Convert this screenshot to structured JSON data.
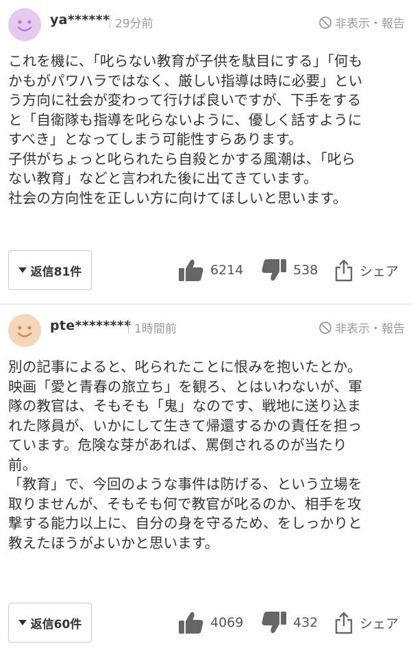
{
  "comments": [
    {
      "username": "ya******",
      "time": "29分前",
      "hide_label": "非表示・報告",
      "body": "これを機に、「叱らない教育が子供を駄目にする」「何も\nかもがパワハラではなく、厳しい指導は時に必要」とい\nう方向に社会が変わって行けば良いですが、下手をする\nと「自衛隊も指導を叱らないように、優しく話すように\nすべき」となってしまう可能性すらあります。\n子供がちょっと叱られたら自殺とかする風潮は、「叱ら\nない教育」などと言われた後に出てきています。\n社会の方向性を正しい方に向けてほしいと思います。",
      "reply_label": "返信81件",
      "likes": "6214",
      "dislikes": "538",
      "share_label": "シェア",
      "avatar_color": "#e6c9ee",
      "avatar_face_color": "#b57ad0"
    },
    {
      "username": "pte********",
      "time": "1時間前",
      "hide_label": "非表示・報告",
      "body": "別の記事によると、叱られたことに恨みを抱いたとか。\n映画「愛と青春の旅立ち」を観ろ、とはいわないが、軍\n隊の教官は、そもそも「鬼」なのです、戦地に送り込ま\nれた隊員が、いかにして生きて帰還するかの責任を担っ\nています。危険な芽があれば、罵倒されるのが当たり\n前。\n「教育」で、今回のような事件は防げる、という立場を\n取りませんが、そもそも何で教官が叱るのか、相手を攻\n撃する能力以上に、自分の身を守るため、をしっかりと\n教えたほうがよいかと思います。",
      "reply_label": "返信60件",
      "likes": "4069",
      "dislikes": "432",
      "share_label": "シェア",
      "avatar_color": "#f6d6b8",
      "avatar_face_color": "#d08a4a"
    }
  ]
}
